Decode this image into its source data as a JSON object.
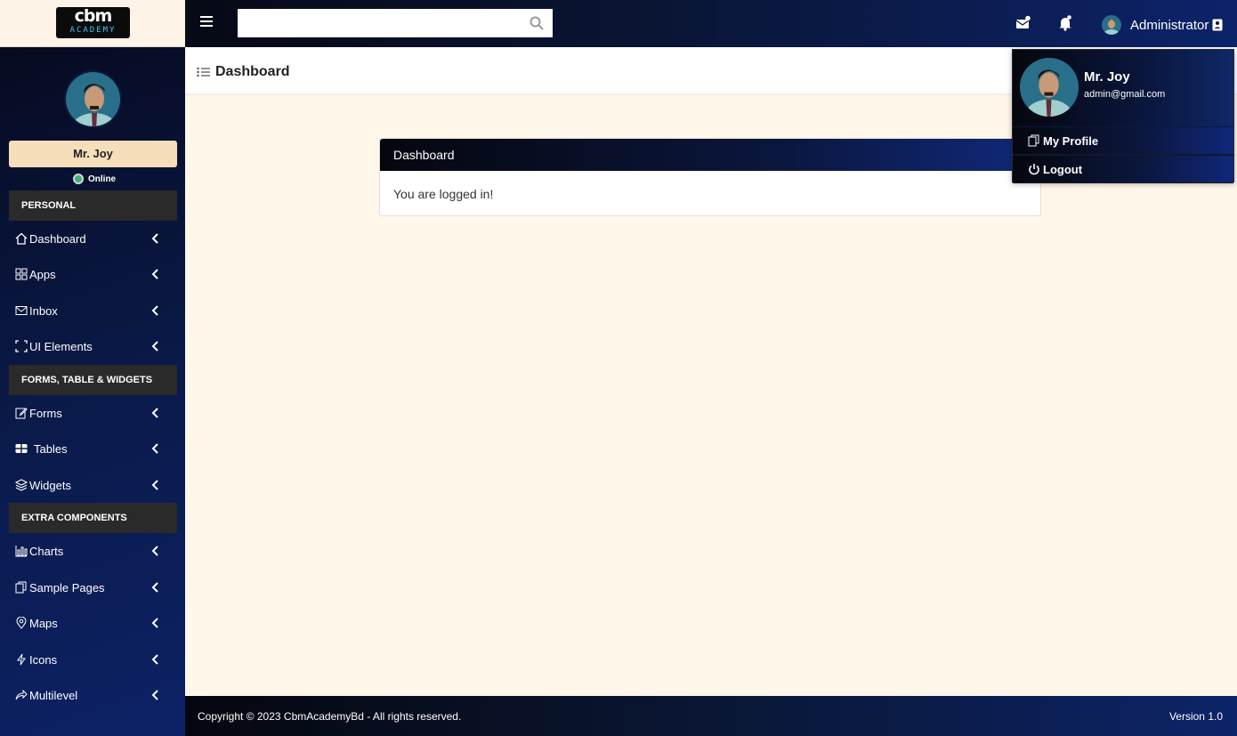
{
  "brand": {
    "logo_top": "cbm",
    "logo_bottom": "ACADEMY"
  },
  "sidebar": {
    "user_name": "Mr. Joy",
    "status": "Online",
    "sections": [
      "PERSONAL",
      "FORMS, TABLE & WIDGETS",
      "EXTRA COMPONENTS"
    ],
    "items": [
      {
        "label": "Dashboard",
        "icon": "home-icon"
      },
      {
        "label": "Apps",
        "icon": "grid-icon"
      },
      {
        "label": "Inbox",
        "icon": "envelope-icon"
      },
      {
        "label": "UI Elements",
        "icon": "frame-icon"
      },
      {
        "label": "Forms",
        "icon": "edit-icon"
      },
      {
        "label": "Tables",
        "icon": "table-icon"
      },
      {
        "label": "Widgets",
        "icon": "layers-icon"
      },
      {
        "label": "Charts",
        "icon": "bar-chart-icon"
      },
      {
        "label": "Sample Pages",
        "icon": "copy-icon"
      },
      {
        "label": "Maps",
        "icon": "map-pin-icon"
      },
      {
        "label": "Icons",
        "icon": "lightning-icon"
      },
      {
        "label": "Multilevel",
        "icon": "share-icon"
      }
    ]
  },
  "topbar": {
    "search_placeholder": "",
    "user_label": "Administrator"
  },
  "page": {
    "title": "Dashboard",
    "card_title": "Dashboard",
    "card_body": "You are logged in!"
  },
  "dropdown": {
    "name": "Mr. Joy",
    "email": "admin@gmail.com",
    "profile_label": "My Profile",
    "logout_label": "Logout"
  },
  "footer": {
    "copyright": "Copyright © 2023 CbmAcademyBd - All rights reserved.",
    "version": "Version 1.0"
  },
  "colors": {
    "nav_dark": "#06091c",
    "nav_blue": "#0c2266",
    "content_bg": "#fff7ea",
    "name_box": "#f6deba",
    "online": "#3fb17a"
  }
}
